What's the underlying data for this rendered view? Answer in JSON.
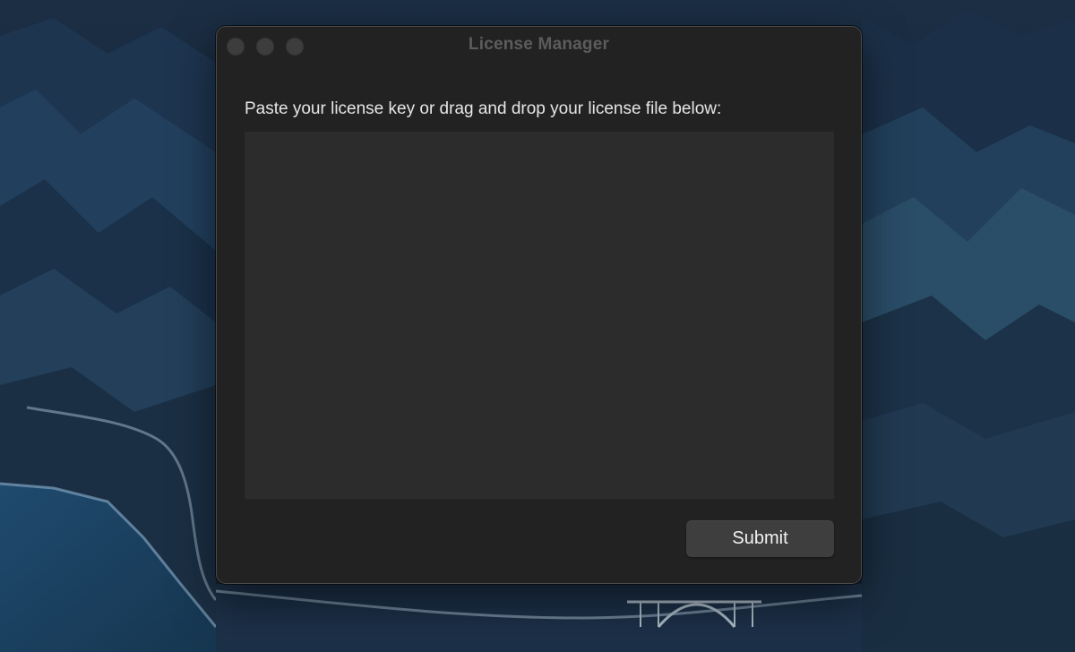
{
  "window": {
    "title": "License Manager"
  },
  "traffic_lights": {
    "close": "close-button",
    "minimize": "minimize-button",
    "zoom": "zoom-button",
    "color_inactive": "#3d3d3d"
  },
  "main": {
    "instruction": "Paste your license key or drag and drop your license file below:",
    "license_input_value": "",
    "submit_label": "Submit"
  },
  "colors": {
    "window_bg": "#222222",
    "input_bg": "#2c2c2c",
    "button_bg": "#3e3e3e",
    "desktop_bg": "#16283a"
  }
}
